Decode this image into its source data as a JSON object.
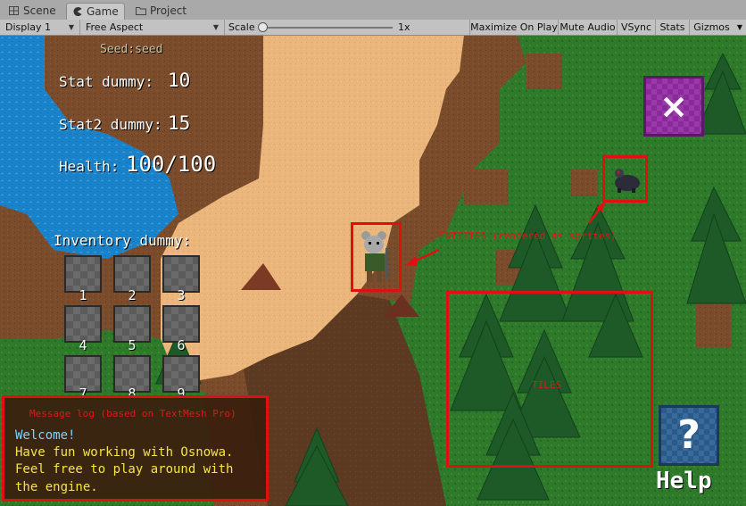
{
  "tabs": [
    {
      "label": "Scene",
      "icon": "scene-grid-icon"
    },
    {
      "label": "Game",
      "icon": "game-pacman-icon"
    },
    {
      "label": "Project",
      "icon": "folder-icon"
    }
  ],
  "toolbar": {
    "display": "Display 1",
    "aspect": "Free Aspect",
    "scale_label": "Scale",
    "scale_value": "1x",
    "maximize": "Maximize On Play",
    "mute": "Mute Audio",
    "vsync": "VSync",
    "stats": "Stats",
    "gizmos": "Gizmos"
  },
  "hud": {
    "seed": "Seed:seed",
    "stat1_label": "Stat dummy:",
    "stat1_value": "10",
    "stat2_label": "Stat2 dummy:",
    "stat2_value": "15",
    "health_label": "Health:",
    "health_value": "100/100",
    "inventory_label": "Inventory dummy:",
    "slots": [
      "1",
      "2",
      "3",
      "4",
      "5",
      "6",
      "7",
      "8",
      "9"
    ],
    "help_label": "Help",
    "help_glyph": "?",
    "close_glyph": "×"
  },
  "annotations": {
    "entities": "ENTITIES (rendered as sprites)",
    "tiles": "TILES",
    "message_log_title": "Message log (based on TextMesh Pro)"
  },
  "message_log": [
    {
      "text": "Welcome!",
      "color": "#7fd4ff"
    },
    {
      "text": "Have fun working with Osnowa.",
      "color": "#f6e542"
    },
    {
      "text": "Feel free to play around with",
      "color": "#f6e542"
    },
    {
      "text": "the engine.",
      "color": "#f6e542"
    }
  ],
  "colors": {
    "water": "#1a7fc4",
    "sand": "#e8b47a",
    "dirt": "#7a4a2a",
    "grass": "#2e7a2a",
    "annotation_red": "#e01010",
    "close_purple": "#8a2a9a",
    "help_blue": "#2a5a8a"
  }
}
